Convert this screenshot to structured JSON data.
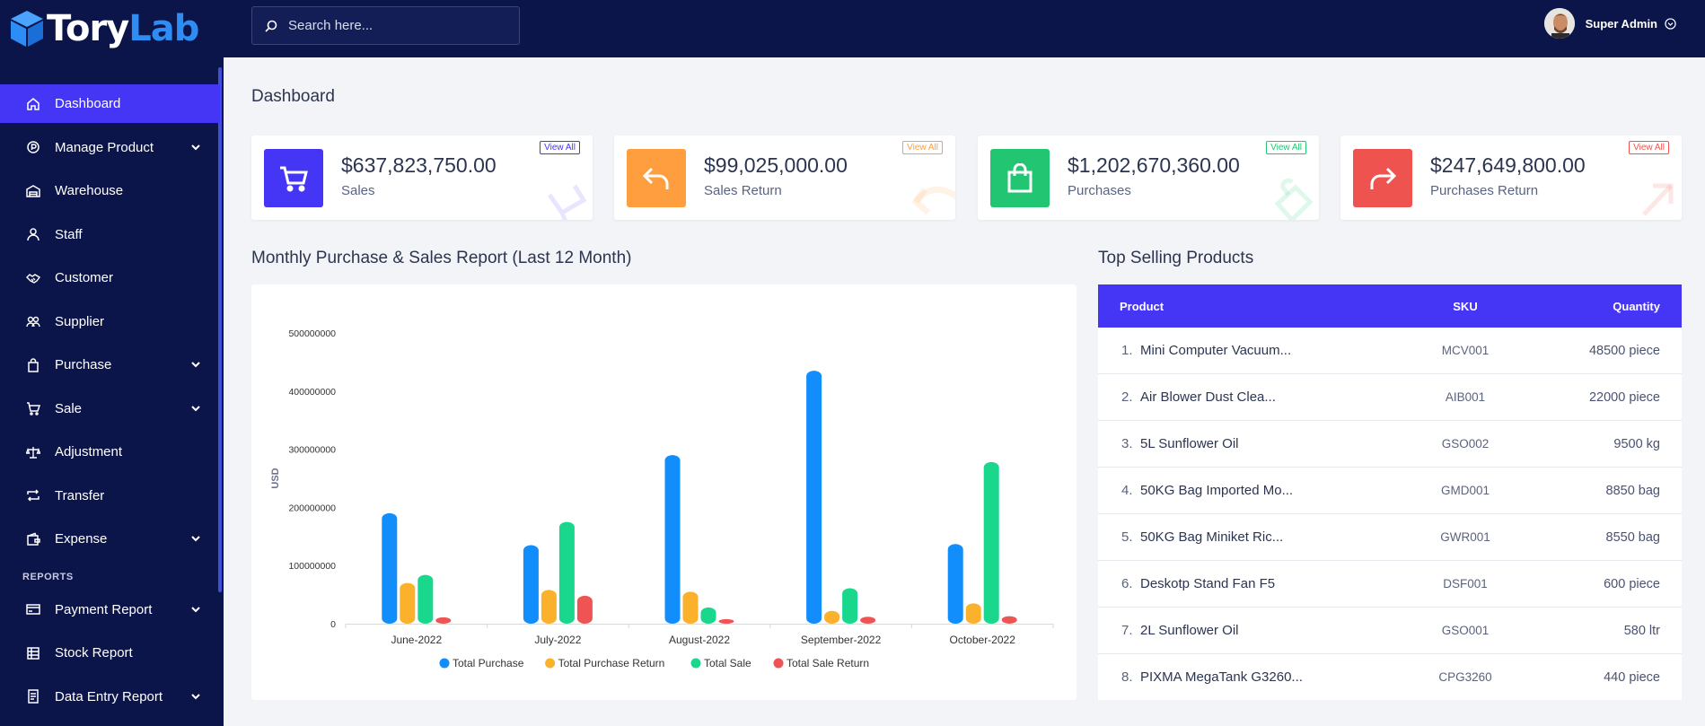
{
  "brand": {
    "name_part1": "Tory",
    "name_part2": "Lab",
    "accent": "#2d8df5"
  },
  "sidebar": {
    "items": [
      {
        "label": "Dashboard",
        "icon": "home-icon",
        "active": true,
        "has_submenu": false
      },
      {
        "label": "Manage Product",
        "icon": "product-icon",
        "has_submenu": true
      },
      {
        "label": "Warehouse",
        "icon": "warehouse-icon",
        "has_submenu": false
      },
      {
        "label": "Staff",
        "icon": "user-icon",
        "has_submenu": false
      },
      {
        "label": "Customer",
        "icon": "handshake-icon",
        "has_submenu": false
      },
      {
        "label": "Supplier",
        "icon": "users-icon",
        "has_submenu": false
      },
      {
        "label": "Purchase",
        "icon": "bag-icon",
        "has_submenu": true
      },
      {
        "label": "Sale",
        "icon": "cart-icon",
        "has_submenu": true
      },
      {
        "label": "Adjustment",
        "icon": "scale-icon",
        "has_submenu": false
      },
      {
        "label": "Transfer",
        "icon": "transfer-icon",
        "has_submenu": false
      },
      {
        "label": "Expense",
        "icon": "wallet-icon",
        "has_submenu": true
      }
    ],
    "reports_title": "REPORTS",
    "reports": [
      {
        "label": "Payment Report",
        "icon": "payment-icon",
        "has_submenu": true
      },
      {
        "label": "Stock Report",
        "icon": "stock-icon",
        "has_submenu": false
      },
      {
        "label": "Data Entry Report",
        "icon": "data-entry-icon",
        "has_submenu": true
      }
    ]
  },
  "header": {
    "search_placeholder": "Search here...",
    "user_name": "Super Admin"
  },
  "page": {
    "title": "Dashboard"
  },
  "stats": [
    {
      "value": "$637,823,750.00",
      "label": "Sales",
      "view_all": "View All",
      "color": "#4535f5",
      "icon": "cart-icon"
    },
    {
      "value": "$99,025,000.00",
      "label": "Sales Return",
      "view_all": "View All",
      "color": "#fe9e3f",
      "icon": "reply-icon"
    },
    {
      "value": "$1,202,670,360.00",
      "label": "Purchases",
      "view_all": "View All",
      "color": "#22c572",
      "icon": "bag-icon"
    },
    {
      "value": "$247,649,800.00",
      "label": "Purchases Return",
      "view_all": "View All",
      "color": "#ef5350",
      "icon": "forward-icon"
    }
  ],
  "chart_section": {
    "title": "Monthly Purchase & Sales Report (Last 12 Month)"
  },
  "chart_data": {
    "type": "bar",
    "categories": [
      "June-2022",
      "July-2022",
      "August-2022",
      "September-2022",
      "October-2022"
    ],
    "series": [
      {
        "name": "Total Purchase",
        "color": "#118efc",
        "values": [
          190000000,
          135000000,
          290000000,
          435000000,
          137000000
        ]
      },
      {
        "name": "Total Purchase Return",
        "color": "#fbb12c",
        "values": [
          70000000,
          58000000,
          55000000,
          22000000,
          35000000
        ]
      },
      {
        "name": "Total Sale",
        "color": "#19d88e",
        "values": [
          84000000,
          175000000,
          28000000,
          61000000,
          278000000
        ]
      },
      {
        "name": "Total Sale Return",
        "color": "#ef5454",
        "values": [
          11000000,
          48000000,
          8000000,
          12000000,
          13000000
        ]
      }
    ],
    "ylabel": "USD",
    "yticks": [
      "0",
      "100000000",
      "200000000",
      "300000000",
      "400000000",
      "500000000"
    ],
    "ylim": [
      0,
      500000000
    ],
    "legend": "bottom",
    "grid": false
  },
  "top_products": {
    "title": "Top Selling Products",
    "columns": [
      "Product",
      "SKU",
      "Quantity"
    ],
    "rows": [
      {
        "num": "1.",
        "product": "Mini Computer Vacuum...",
        "sku": "MCV001",
        "qty": "48500 piece"
      },
      {
        "num": "2.",
        "product": "Air Blower Dust Clea...",
        "sku": "AIB001",
        "qty": "22000 piece"
      },
      {
        "num": "3.",
        "product": "5L Sunflower Oil",
        "sku": "GSO002",
        "qty": "9500 kg"
      },
      {
        "num": "4.",
        "product": "50KG Bag Imported Mo...",
        "sku": "GMD001",
        "qty": "8850 bag"
      },
      {
        "num": "5.",
        "product": "50KG Bag Miniket Ric...",
        "sku": "GWR001",
        "qty": "8550 bag"
      },
      {
        "num": "6.",
        "product": "Deskotp Stand Fan F5",
        "sku": "DSF001",
        "qty": "600 piece"
      },
      {
        "num": "7.",
        "product": "2L Sunflower Oil",
        "sku": "GSO001",
        "qty": "580 ltr"
      },
      {
        "num": "8.",
        "product": "PIXMA MegaTank G3260...",
        "sku": "CPG3260",
        "qty": "440 piece"
      }
    ]
  }
}
